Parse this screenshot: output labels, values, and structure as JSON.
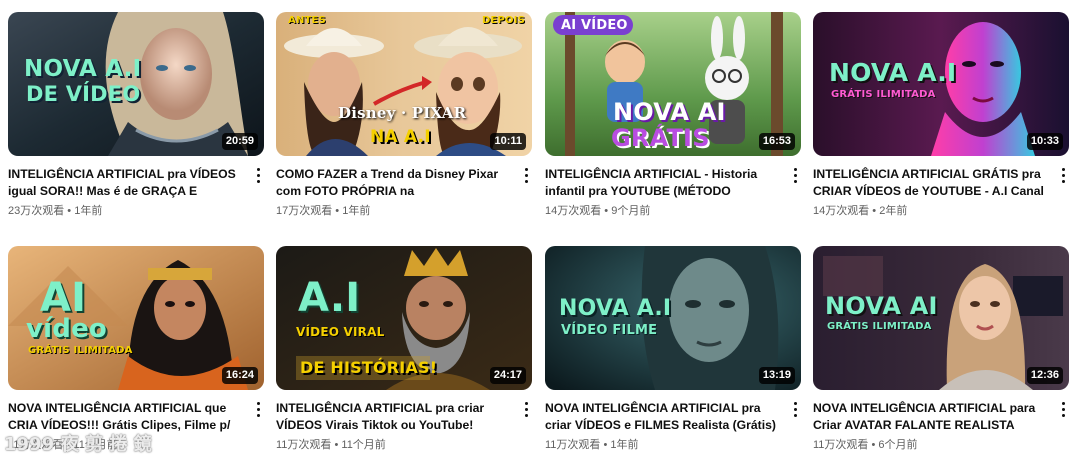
{
  "videos": [
    {
      "overlay": [
        "NOVA A.I",
        "DE VÍDEO"
      ],
      "duration": "20:59",
      "title": "INTELIGÊNCIA ARTIFICIAL pra VÍDEOS igual SORA!! Mas é de GRAÇA E ILIMITADA",
      "views": "23万次观看",
      "age": "1年前"
    },
    {
      "overlay": [
        "ANTES",
        "DEPOIS",
        "Disney · PIXAR",
        "NA A.I"
      ],
      "duration": "10:11",
      "title": "COMO FAZER a Trend da Disney Pixar com FOTO PRÓPRIA na INTELIGÊNCIA...",
      "views": "17万次观看",
      "age": "1年前"
    },
    {
      "overlay": [
        "AI VÍDEO",
        "NOVA AI",
        "GRÁTIS"
      ],
      "duration": "16:53",
      "title": "INTELIGÊNCIA ARTIFICIAL - Historia infantil pra YOUTUBE (MÉTODO DESATUALIZADO-...",
      "views": "14万次观看",
      "age": "9个月前"
    },
    {
      "overlay": [
        "NOVA A.I",
        "GRÁTIS ILIMITADA"
      ],
      "duration": "10:33",
      "title": "INTELIGÊNCIA ARTIFICIAL GRÁTIS pra CRIAR VÍDEOS de YOUTUBE - A.I Canal Dark",
      "views": "14万次观看",
      "age": "2年前"
    },
    {
      "overlay": [
        "AI",
        "vídeo",
        "GRÁTIS ILIMITADA"
      ],
      "duration": "16:24",
      "title": "NOVA INTELIGÊNCIA ARTIFICIAL que CRIA VÍDEOS!!! Grátis Clipes, Filme p/ Youtube...",
      "views": "11万次观看",
      "age": "11个月前"
    },
    {
      "overlay": [
        "A.I",
        "VÍDEO VIRAL",
        "DE HISTÓRIAS!"
      ],
      "duration": "24:17",
      "title": "INTELIGÊNCIA ARTIFICIAL pra criar VÍDEOS Virais Tiktok ou YouTube!",
      "views": "11万次观看",
      "age": "11个月前"
    },
    {
      "overlay": [
        "NOVA A.I",
        "VÍDEO FILME"
      ],
      "duration": "13:19",
      "title": "NOVA INTELIGÊNCIA ARTIFICIAL pra criar VÍDEOS e FILMES Realista (Grátis) LUMA...",
      "views": "11万次观看",
      "age": "1年前"
    },
    {
      "overlay": [
        "NOVA AI",
        "GRÁTIS ILIMITADA"
      ],
      "duration": "12:36",
      "title": "NOVA INTELIGÊNCIA ARTIFICIAL para Criar AVATAR FALANTE REALISTA (Youtube) [A...",
      "views": "11万次观看",
      "age": "6个月前"
    }
  ],
  "separator": " • ",
  "watermark": "1999·夜 剪 捲 鏡",
  "colors": {
    "title": "#0f0f0f",
    "stats": "#606060",
    "overlay_green": "#7ef0c8",
    "overlay_yellow": "#f5d000",
    "overlay_pink": "#e040a0"
  }
}
